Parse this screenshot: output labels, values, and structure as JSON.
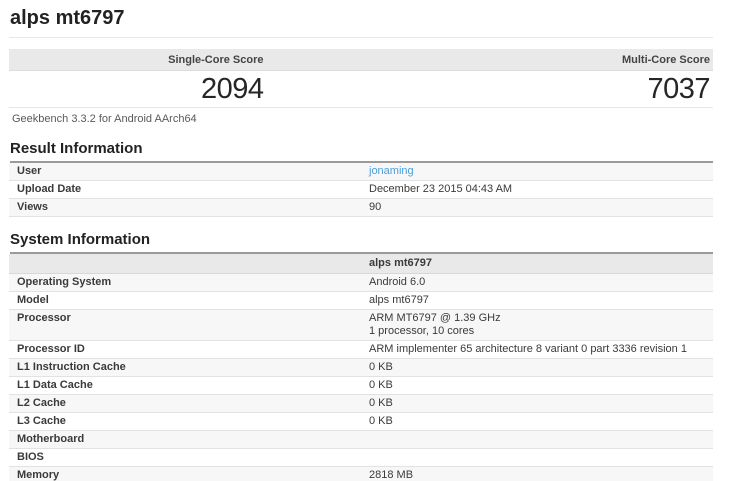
{
  "page": {
    "title": "alps mt6797",
    "geekbench_version": "Geekbench 3.3.2 for Android AArch64"
  },
  "scores": {
    "single_core_label": "Single-Core Score",
    "single_core_value": "2094",
    "multi_core_label": "Multi-Core Score",
    "multi_core_value": "7037"
  },
  "result_information": {
    "heading": "Result Information",
    "rows": [
      {
        "label": "User",
        "value": "jonaming"
      },
      {
        "label": "Upload Date",
        "value": "December 23 2015 04:43 AM"
      },
      {
        "label": "Views",
        "value": "90"
      }
    ]
  },
  "system_information": {
    "heading": "System Information",
    "header_value": "alps mt6797",
    "rows": [
      {
        "label": "Operating System",
        "value": "Android 6.0"
      },
      {
        "label": "Model",
        "value": "alps mt6797"
      },
      {
        "label": "Processor",
        "value": "ARM MT6797 @ 1.39 GHz",
        "value2": "1 processor, 10 cores"
      },
      {
        "label": "Processor ID",
        "value": "ARM implementer 65 architecture 8 variant 0 part 3336 revision 1"
      },
      {
        "label": "L1 Instruction Cache",
        "value": "0 KB"
      },
      {
        "label": "L1 Data Cache",
        "value": "0 KB"
      },
      {
        "label": "L2 Cache",
        "value": "0 KB"
      },
      {
        "label": "L3 Cache",
        "value": "0 KB"
      },
      {
        "label": "Motherboard",
        "value": ""
      },
      {
        "label": "BIOS",
        "value": ""
      },
      {
        "label": "Memory",
        "value": "2818 MB"
      }
    ]
  },
  "colors": {
    "link_blue": "#4a9ed9",
    "header_bar_bg": "#e9e9e9",
    "stripe_bg": "#f7f7f7",
    "heading_underline": "#9a9a9a"
  }
}
